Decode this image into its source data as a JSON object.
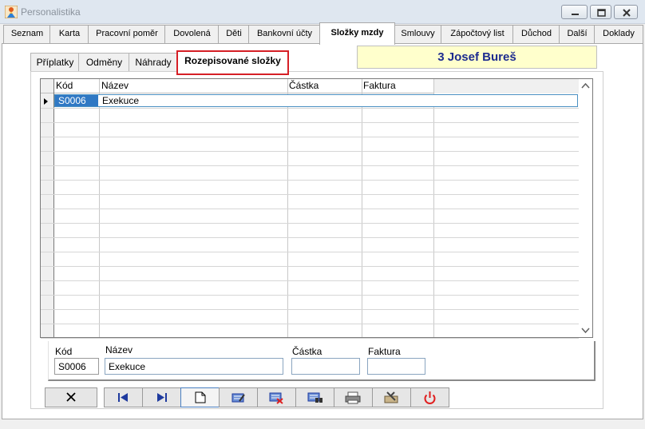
{
  "window": {
    "title": "Personalistika"
  },
  "main_tabs": [
    {
      "label": "Seznam"
    },
    {
      "label": "Karta"
    },
    {
      "label": "Pracovní poměr"
    },
    {
      "label": "Dovolená"
    },
    {
      "label": "Děti"
    },
    {
      "label": "Bankovní účty"
    },
    {
      "label": "Složky mzdy"
    },
    {
      "label": "Smlouvy"
    },
    {
      "label": "Zápočtový list"
    },
    {
      "label": "Důchod"
    },
    {
      "label": "Další"
    },
    {
      "label": "Doklady"
    }
  ],
  "sub_tabs": [
    {
      "label": "Příplatky"
    },
    {
      "label": "Odměny"
    },
    {
      "label": "Náhrady"
    },
    {
      "label": "Rozepisované složky"
    }
  ],
  "employee": {
    "label": "3 Josef Bureš"
  },
  "grid": {
    "columns": [
      "Kód",
      "Název",
      "Částka",
      "Faktura"
    ],
    "rows": [
      {
        "kod": "S0006",
        "nazev": "Exekuce",
        "castka": "",
        "faktura": ""
      }
    ]
  },
  "detail": {
    "labels": {
      "kod": "Kód",
      "nazev": "Název",
      "castka": "Částka",
      "faktura": "Faktura"
    },
    "values": {
      "kod": "S0006",
      "nazev": "Exekuce",
      "castka": "",
      "faktura": ""
    }
  },
  "toolbar": {
    "buttons": [
      "close-icon",
      "first-record-icon",
      "last-record-icon",
      "new-document-icon",
      "edit-record-icon",
      "delete-record-icon",
      "find-record-icon",
      "print-icon",
      "tools-icon",
      "power-icon"
    ]
  },
  "colors": {
    "selected_tab_border": "#d61f26",
    "employee_bg": "#ffffcc",
    "employee_text": "#1d2b8f",
    "power_red": "#e02020"
  }
}
